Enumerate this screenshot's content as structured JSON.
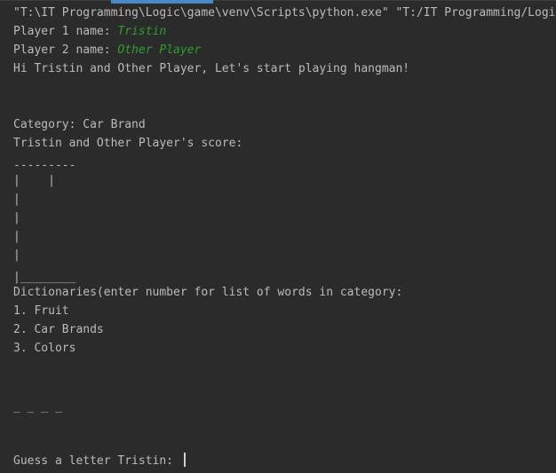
{
  "console": {
    "command": "\"T:\\IT Programming\\Logic\\game\\venv\\Scripts\\python.exe\" \"T:/IT Programming/Logic",
    "player1_prompt": "Player 1 name: ",
    "player1_name": "Tristin",
    "player2_prompt": "Player 2 name: ",
    "player2_name": "Other Player",
    "greeting": "Hi Tristin and Other Player, Let's start playing hangman!",
    "category": "Category: Car Brand",
    "score": "Tristin and Other Player's score:",
    "hangman": [
      "---------",
      "|    |",
      "|",
      "|",
      "|",
      "|",
      "|________"
    ],
    "dictionaries_header": "Dictionaries(enter number for list of words in category:",
    "dictionaries": [
      "1. Fruit",
      "2. Car Brands",
      "3. Colors"
    ],
    "word_blanks": "_ _ _ _",
    "guess_prompt": "Guess a letter Tristin: "
  },
  "colors": {
    "background": "#2b2b2b",
    "output_text": "#bbbbbb",
    "user_input": "#2f9e2f",
    "scroll_indicator": "#4a88c7"
  }
}
